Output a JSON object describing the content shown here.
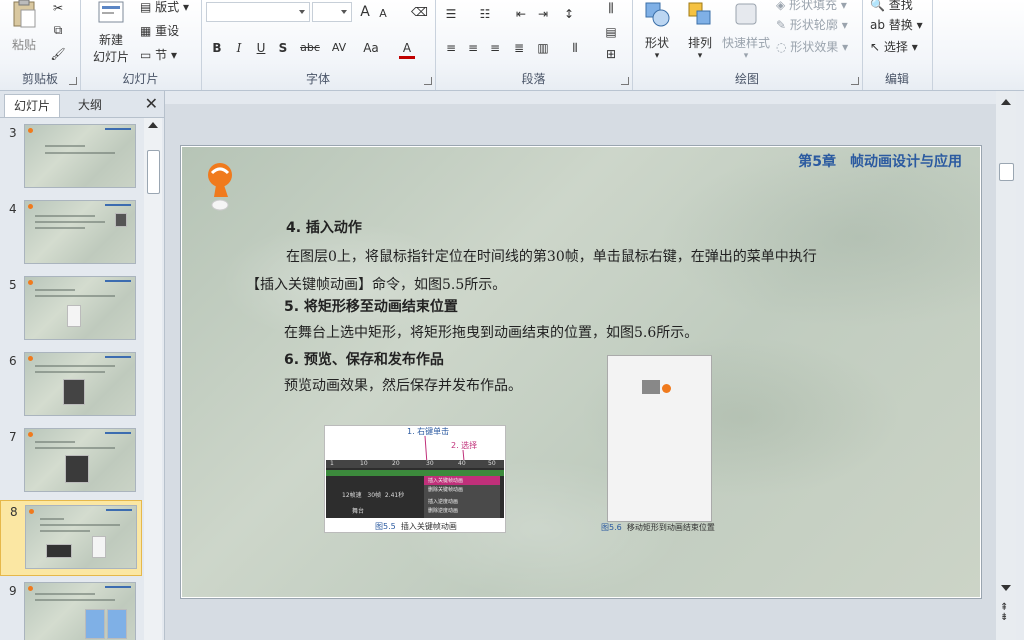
{
  "ribbon": {
    "clipboard": {
      "paste_label": "粘贴",
      "group_label": "剪贴板"
    },
    "slides": {
      "new_slide_line1": "新建",
      "new_slide_line2": "幻灯片",
      "layout_label": "版式",
      "reset_label": "重设",
      "section_label": "节",
      "group_label": "幻灯片"
    },
    "font": {
      "group_label": "字体",
      "bold": "B",
      "italic": "I",
      "underline": "U",
      "shadow": "S",
      "strike": "abc",
      "spacing": "AV",
      "case": "Aa",
      "grow": "A",
      "shrink": "A",
      "color": "A"
    },
    "paragraph": {
      "group_label": "段落"
    },
    "drawing": {
      "shapes_label": "形状",
      "arrange_label": "排列",
      "quick_styles_label": "快速样式",
      "fill_label": "形状填充",
      "outline_label": "形状轮廓",
      "effects_label": "形状效果",
      "group_label": "绘图"
    },
    "editing": {
      "find_label": "查找",
      "replace_label": "替换",
      "select_label": "选择",
      "group_label": "编辑"
    }
  },
  "panel": {
    "tabs": [
      "幻灯片",
      "大纲"
    ],
    "close": "✕",
    "slide_numbers": [
      "3",
      "4",
      "5",
      "6",
      "7",
      "8",
      "9"
    ],
    "selected_slide": "8"
  },
  "slide": {
    "chapter": "第5章　帧动画设计与应用",
    "heading4": "4. 插入动作",
    "para4_line1": "在图层0上，将鼠标指针定位在时间线的第30帧，单击鼠标右键，在弹出的菜单中执行",
    "para4_line2": "【插入关键帧动画】命令，如图5.5所示。",
    "heading5": "5. 将矩形移至动画结束位置",
    "para5": "在舞台上选中矩形，将矩形拖曳到动画结束的位置，如图5.6所示。",
    "heading6": "6. 预览、保存和发布作品",
    "para6": "预览动画效果，然后保存并发布作品。",
    "fig55": {
      "callout1": "1. 右键单击",
      "callout2": "2. 选择",
      "ticks": [
        "1",
        "10",
        "20",
        "30",
        "40",
        "50"
      ],
      "menu_items": [
        "插入关键帧动画",
        "删除关键帧动画",
        "插入逆度动画",
        "删除逆度动画"
      ],
      "status_fps": "12帧速",
      "status_frame": "30帧",
      "status_time": "2.41秒",
      "stage_tab": "舞台",
      "caption_num": "图5.5",
      "caption_text": "插入关键帧动画"
    },
    "fig56": {
      "caption_num": "图5.6",
      "caption_text": "移动矩形到动画结束位置"
    }
  },
  "colors": {
    "accent_blue": "#2b5aa0",
    "mascot_orange": "#f07a1d",
    "selection_yellow": "#fbe7a3",
    "callout_pink": "#c0307a"
  }
}
